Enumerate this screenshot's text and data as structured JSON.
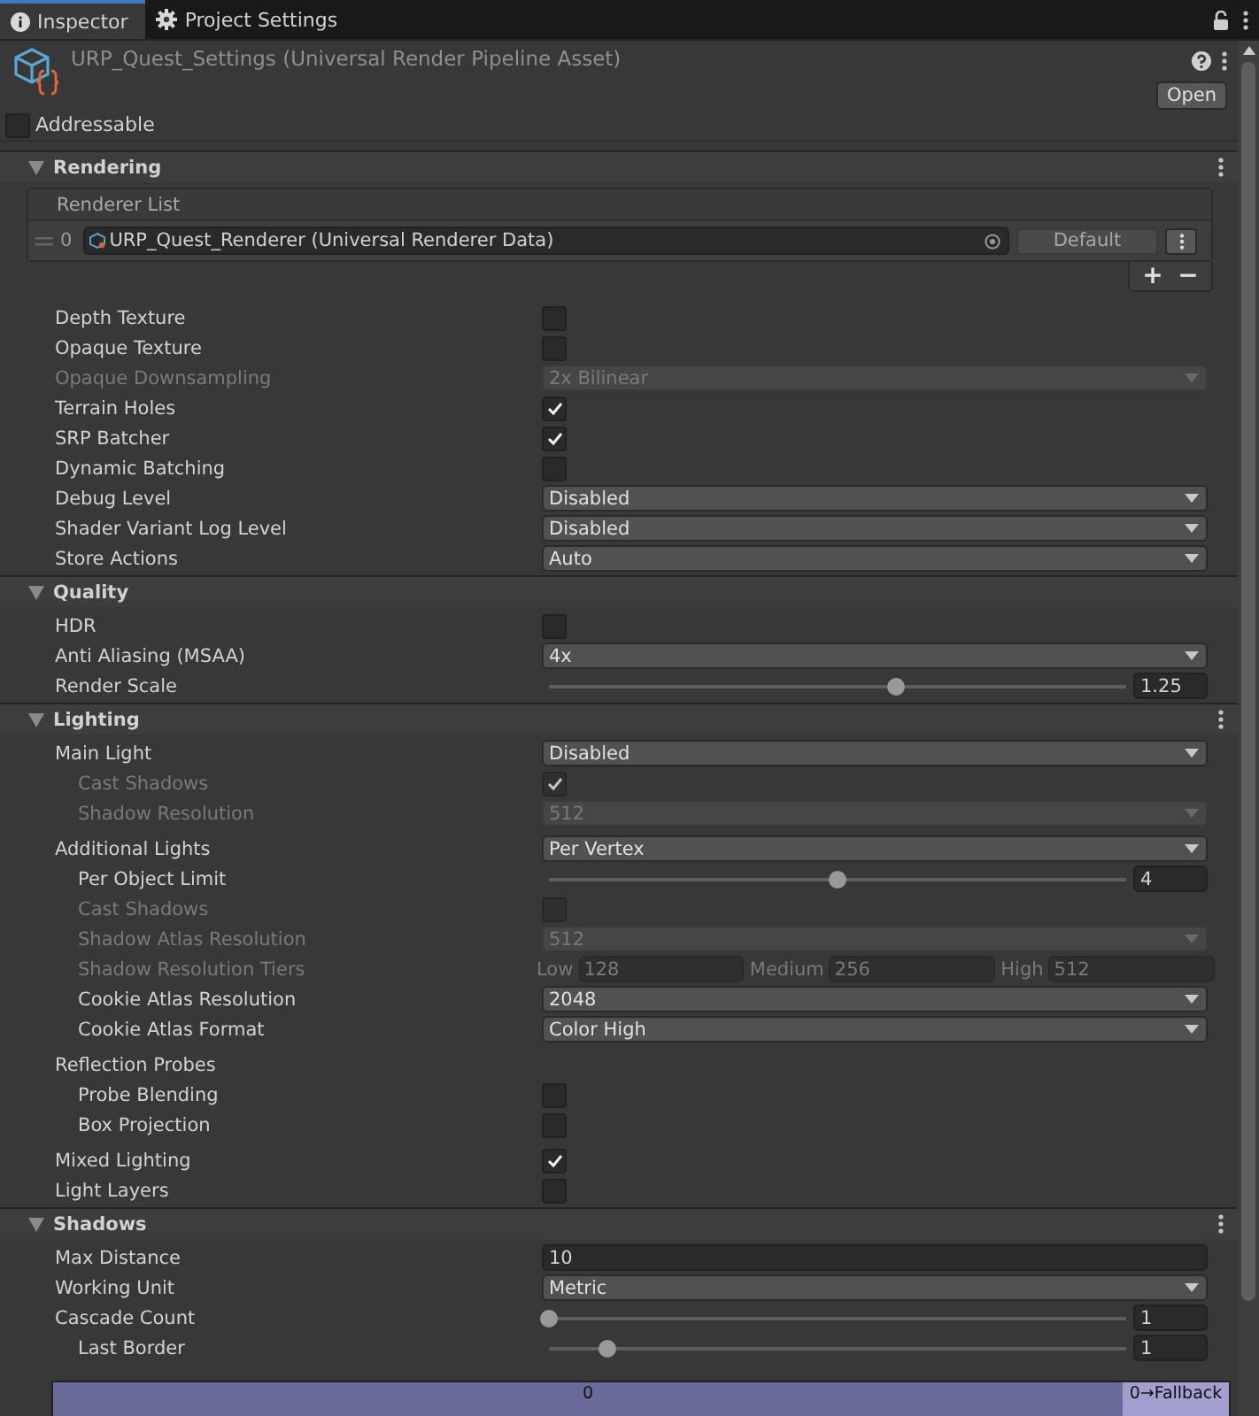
{
  "tabs": [
    {
      "label": "Inspector",
      "selected": true
    },
    {
      "label": "Project Settings",
      "selected": false
    }
  ],
  "asset": {
    "title": "URP_Quest_Settings (Universal Render Pipeline Asset)",
    "open_button": "Open"
  },
  "addressable": {
    "label": "Addressable",
    "checked": false
  },
  "sections": [
    {
      "title": "Rendering",
      "expanded": true,
      "menu": true,
      "renderer_list": {
        "title": "Renderer List",
        "items": [
          {
            "index": "0",
            "value": "URP_Quest_Renderer (Universal Renderer Data)",
            "button": "Default"
          }
        ],
        "add": "+",
        "remove": "−"
      },
      "rows": [
        {
          "label": "Depth Texture",
          "kind": "checkbox",
          "checked": false,
          "disabled": false
        },
        {
          "label": "Opaque Texture",
          "kind": "checkbox",
          "checked": false,
          "disabled": false
        },
        {
          "label": "Opaque Downsampling",
          "kind": "dropdown",
          "value": "2x Bilinear",
          "disabled": true
        },
        {
          "label": "Terrain Holes",
          "kind": "checkbox",
          "checked": true,
          "disabled": false
        },
        {
          "label": "SRP Batcher",
          "kind": "checkbox",
          "checked": true,
          "disabled": false
        },
        {
          "label": "Dynamic Batching",
          "kind": "checkbox",
          "checked": false,
          "disabled": false
        },
        {
          "label": "Debug Level",
          "kind": "dropdown",
          "value": "Disabled",
          "disabled": false
        },
        {
          "label": "Shader Variant Log Level",
          "kind": "dropdown",
          "value": "Disabled",
          "disabled": false
        },
        {
          "label": "Store Actions",
          "kind": "dropdown",
          "value": "Auto",
          "disabled": false
        }
      ]
    },
    {
      "title": "Quality",
      "expanded": true,
      "menu": false,
      "rows": [
        {
          "label": "HDR",
          "kind": "checkbox",
          "checked": false,
          "disabled": false
        },
        {
          "label": "Anti Aliasing (MSAA)",
          "kind": "dropdown",
          "value": "4x",
          "disabled": false
        },
        {
          "label": "Render Scale",
          "kind": "slider",
          "level": 0.6,
          "value": "1.25",
          "disabled": false
        }
      ]
    },
    {
      "title": "Lighting",
      "expanded": true,
      "menu": true,
      "rows": [
        {
          "label": "Main Light",
          "kind": "dropdown",
          "value": "Disabled",
          "disabled": false,
          "children": [
            {
              "label": "Cast Shadows",
              "kind": "checkbox",
              "checked": true,
              "disabled": true
            },
            {
              "label": "Shadow Resolution",
              "kind": "dropdown",
              "value": "512",
              "disabled": true
            }
          ]
        },
        {
          "label": "Additional Lights",
          "kind": "dropdown",
          "value": "Per Vertex",
          "disabled": false,
          "children": [
            {
              "label": "Per Object Limit",
              "kind": "slider",
              "level": 0.5,
              "value": "4",
              "disabled": false
            },
            {
              "label": "Cast Shadows",
              "kind": "checkbox",
              "checked": false,
              "disabled": true
            },
            {
              "label": "Shadow Atlas Resolution",
              "kind": "dropdown",
              "value": "512",
              "disabled": true
            },
            {
              "label": "Shadow Resolution Tiers",
              "kind": "tiers",
              "disabled": true,
              "tiers": [
                {
                  "label": "Low",
                  "value": "128"
                },
                {
                  "label": "Medium",
                  "value": "256"
                },
                {
                  "label": "High",
                  "value": "512"
                }
              ]
            },
            {
              "label": "Cookie Atlas Resolution",
              "kind": "dropdown",
              "value": "2048",
              "disabled": false
            },
            {
              "label": "Cookie Atlas Format",
              "kind": "dropdown",
              "value": "Color High",
              "disabled": false
            }
          ]
        },
        {
          "label": "Reflection Probes",
          "kind": "label",
          "disabled": false,
          "children": [
            {
              "label": "Probe Blending",
              "kind": "checkbox",
              "checked": false,
              "disabled": false
            },
            {
              "label": "Box Projection",
              "kind": "checkbox",
              "checked": false,
              "disabled": false
            }
          ]
        },
        {
          "label": "Mixed Lighting",
          "kind": "checkbox",
          "checked": true,
          "disabled": false
        },
        {
          "label": "Light Layers",
          "kind": "checkbox",
          "checked": false,
          "disabled": false
        }
      ]
    },
    {
      "title": "Shadows",
      "expanded": true,
      "menu": true,
      "rows": [
        {
          "label": "Max Distance",
          "kind": "field",
          "value": "10",
          "disabled": false
        },
        {
          "label": "Working Unit",
          "kind": "dropdown",
          "value": "Metric",
          "disabled": false
        },
        {
          "label": "Cascade Count",
          "kind": "slider",
          "level": 0,
          "value": "1",
          "disabled": false,
          "children": [
            {
              "label": "Last Border",
              "kind": "slider",
              "level": 0.1,
              "value": "1",
              "disabled": false
            }
          ]
        }
      ],
      "cascade_bar": [
        {
          "label": "0",
          "color": "#6a6a98"
        },
        {
          "label": "0→Fallback",
          "color": "#a29ed0"
        }
      ]
    }
  ]
}
